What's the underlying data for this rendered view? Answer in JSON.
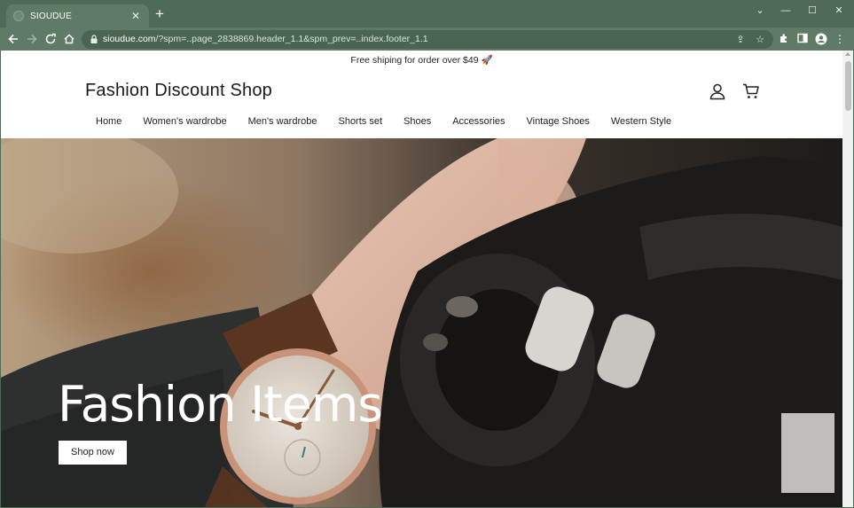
{
  "browser": {
    "tab_title": "SIOUDUE",
    "url_host": "sioudue.com",
    "url_rest": "/?spm=..page_2838869.header_1.1&spm_prev=..index.footer_1.1",
    "icons": {
      "back": "arrow-left-icon",
      "forward": "arrow-right-icon",
      "reload": "reload-icon",
      "home": "home-icon",
      "lock": "lock-icon",
      "share": "share-icon",
      "star": "star-icon",
      "extensions": "puzzle-icon",
      "sidepanel": "sidepanel-icon",
      "profile": "profile-icon",
      "menu": "kebab-menu-icon"
    }
  },
  "store": {
    "announcement": "Free shiping for order over $49",
    "announcement_emoji": "🚀",
    "logo": "Fashion Discount Shop",
    "nav": [
      "Home",
      "Women's wardrobe",
      "Men's wardrobe",
      "Shorts set",
      "Shoes",
      "Accessories",
      "Vintage Shoes",
      "Western Style"
    ],
    "hero": {
      "title": "Fashion Items",
      "button": "Shop now"
    }
  },
  "colors": {
    "chrome_frame": "#4f6b57",
    "chrome_toolbar": "#5f7b66",
    "page_bg": "#ffffff",
    "button_bg": "#ffffff"
  }
}
